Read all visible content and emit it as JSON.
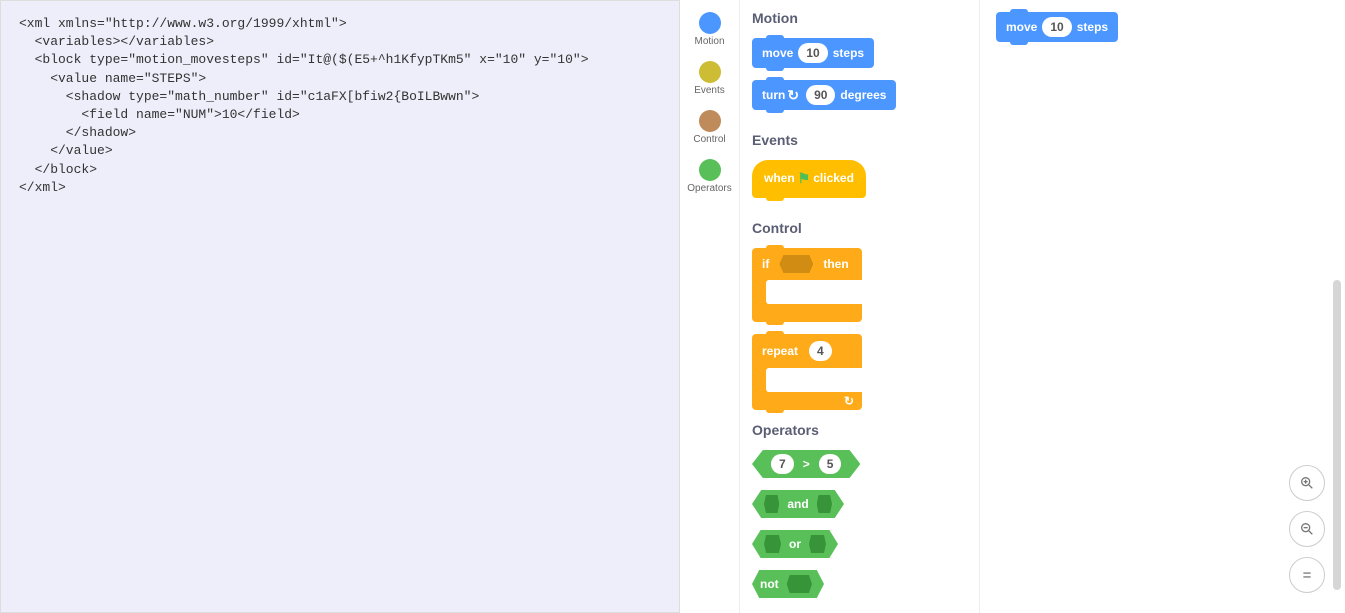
{
  "xml_lines": [
    "<xml xmlns=\"http://www.w3.org/1999/xhtml\">",
    "  <variables></variables>",
    "  <block type=\"motion_movesteps\" id=\"It@($(E5+^h1KfypTKm5\" x=\"10\" y=\"10\">",
    "    <value name=\"STEPS\">",
    "      <shadow type=\"math_number\" id=\"c1aFX[bfiw2{BoILBwwn\">",
    "        <field name=\"NUM\">10</field>",
    "      </shadow>",
    "    </value>",
    "  </block>",
    "</xml>"
  ],
  "categories": [
    {
      "label": "Motion",
      "color": "#4C97FF"
    },
    {
      "label": "Events",
      "color": "#CDBD35"
    },
    {
      "label": "Control",
      "color": "#BF8B5A"
    },
    {
      "label": "Operators",
      "color": "#59C059"
    }
  ],
  "headings": {
    "motion": "Motion",
    "events": "Events",
    "control": "Control",
    "operators": "Operators"
  },
  "blocks": {
    "move": {
      "pre": "move",
      "val": "10",
      "post": "steps"
    },
    "turn": {
      "pre": "turn",
      "val": "90",
      "post": "degrees"
    },
    "whenflag": {
      "pre": "when",
      "post": "clicked"
    },
    "if": {
      "pre": "if",
      "post": "then"
    },
    "repeat": {
      "pre": "repeat",
      "val": "4"
    },
    "gt": {
      "a": "7",
      "op": ">",
      "b": "5"
    },
    "and": {
      "op": "and"
    },
    "or": {
      "op": "or"
    },
    "not": {
      "op": "not"
    }
  },
  "workspace_block": {
    "pre": "move",
    "val": "10",
    "post": "steps"
  },
  "zoom": {
    "in": "+",
    "out": "−",
    "reset": "="
  }
}
